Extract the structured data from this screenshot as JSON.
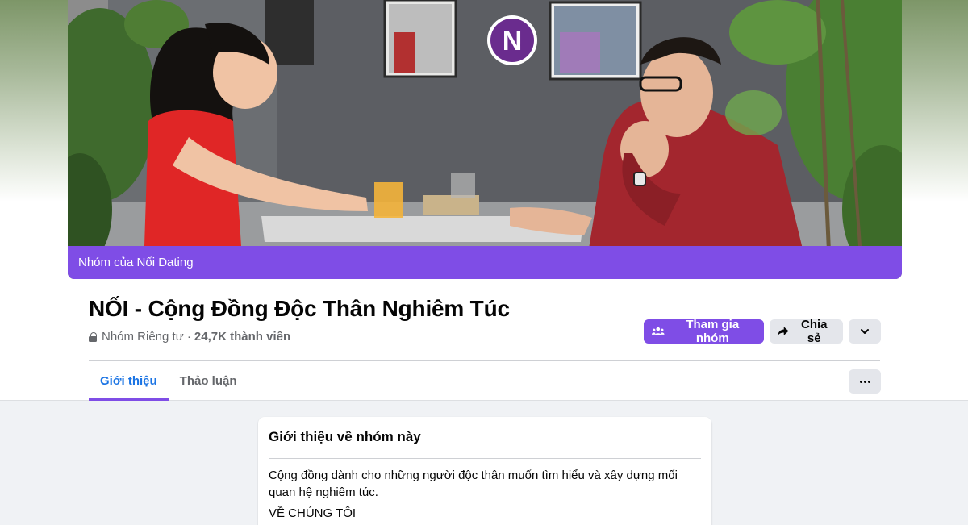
{
  "cover": {
    "banner_text": "Nhóm của Nối Dating",
    "logo_letter": "N",
    "colors": {
      "accent": "#7f4de6",
      "dress": "#e02626",
      "shirt": "#a3262e"
    }
  },
  "group": {
    "title": "NỐI - Cộng Đồng Độc Thân Nghiêm Túc",
    "privacy": "Nhóm Riêng tư ·",
    "members": "24,7K thành viên"
  },
  "actions": {
    "join_label": "Tham gia nhóm",
    "share_label": "Chia sẻ"
  },
  "tabs": [
    {
      "label": "Giới thiệu",
      "active": true
    },
    {
      "label": "Thảo luận",
      "active": false
    }
  ],
  "about": {
    "title": "Giới thiệu về nhóm này",
    "description": "Cộng đồng dành cho những người độc thân muốn tìm hiểu và xây dựng mối quan hệ nghiêm túc.",
    "subheading": "VỀ CHÚNG TÔI"
  }
}
